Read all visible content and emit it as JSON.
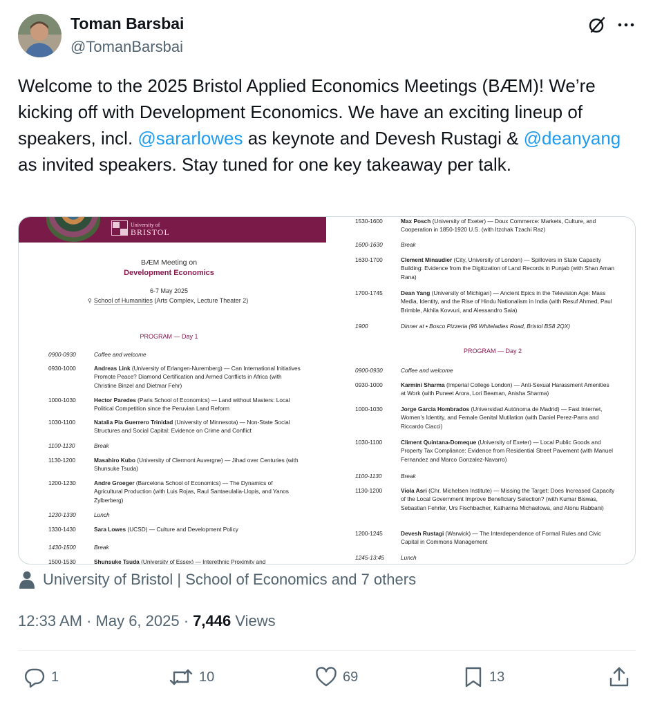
{
  "author": {
    "name": "Toman Barsbai",
    "handle": "@TomanBarsbai"
  },
  "icons": {
    "grok": "grok-icon",
    "more": "more-icon",
    "tagged": "person-icon",
    "reply": "reply-icon",
    "retweet": "retweet-icon",
    "like": "like-icon",
    "bookmark": "bookmark-icon",
    "share": "share-icon"
  },
  "tweet": {
    "text_part1": "Welcome to the 2025 Bristol Applied Economics Meetings (BÆM)! We’re kicking off with Development Economics. We have an exciting lineup of speakers, incl. ",
    "mention1": "@sararlowes",
    "text_part2": " as keynote and Devesh Rustagi & ",
    "mention2": "@deanyang",
    "text_part3": " as invited speakers. Stay tuned for one key takeaway per talk."
  },
  "media": {
    "logo_small": "University of",
    "logo_big": "BRISTOL",
    "meeting_title": "BÆM Meeting on",
    "meeting_subtitle": "Development Economics",
    "dates": "6-7 May 2025",
    "venue_name": "School of Humanities",
    "venue_detail": " (Arts Complex, Lecture Theater 2)",
    "day1_heading": "PROGRAM — Day 1",
    "day2_heading": "PROGRAM — Day 2",
    "day1": [
      {
        "time": "0900-0930",
        "speaker": "",
        "text": "Coffee and welcome",
        "brk": true
      },
      {
        "time": "0930-1000",
        "speaker": "Andreas Link",
        "text": " (University of Erlangen-Nuremberg) — Can International Initiatives Promote Peace? Diamond Certification and Armed Conflicts in Africa (with Christine Binzel and Dietmar Fehr)",
        "brk": false
      },
      {
        "time": "1000-1030",
        "speaker": "Hector Paredes",
        "text": " (Paris School of Economics) — Land without Masters: Local Political Competition since the Peruvian Land Reform",
        "brk": false
      },
      {
        "time": "1030-1100",
        "speaker": "Natalia Pia Guerrero Trinidad",
        "text": " (University of Minnesota) — Non-State Social Structures and Social Capital: Evidence on Crime and Conflict",
        "brk": false
      },
      {
        "time": "1100-1130",
        "speaker": "",
        "text": "Break",
        "brk": true
      },
      {
        "time": "1130-1200",
        "speaker": "Masahiro Kubo",
        "text": " (University of Clermont Auvergne) — Jihad over Centuries (with Shunsuke Tsuda)",
        "brk": false
      },
      {
        "time": "1200-1230",
        "speaker": "Andre Groeger",
        "text": " (Barcelona School of Economics) — The Dynamics of Agricultural Production (with Luis Rojas, Raul Santaeulalia-Llopis, and Yanos Zylberberg)",
        "brk": false
      },
      {
        "time": "1230-1330",
        "speaker": "",
        "text": "Lunch",
        "brk": true
      },
      {
        "time": "1330-1430",
        "speaker": "Sara Lowes",
        "text": " (UCSD) — Culture and Development Policy",
        "brk": false
      },
      {
        "time": "1430-1500",
        "speaker": "",
        "text": "Break",
        "brk": true
      },
      {
        "time": "1500-1530",
        "speaker": "Shunsuke Tsuda",
        "text": " (University of Essex) — Interethnic Proximity and",
        "brk": false
      }
    ],
    "day1_top": [
      {
        "time": "1530-1600",
        "speaker": "Max Posch",
        "text": " (University of Exeter) — Doux Commerce: Markets, Culture, and Cooperation in 1850-1920 U.S. (with Itzchak Tzachi Raz)",
        "brk": false
      },
      {
        "time": "1600-1630",
        "speaker": "",
        "text": "Break",
        "brk": true
      },
      {
        "time": "1630-1700",
        "speaker": "Clement Minaudier",
        "text": " (City, University of London) — Spillovers in State Capacity Building: Evidence from the Digitization of Land Records in Punjab (with Shan Aman Rana)",
        "brk": false
      },
      {
        "time": "1700-1745",
        "speaker": "Dean Yang",
        "text": " (University of Michigan) — Ancient Epics in the Television Age: Mass Media, Identity, and the Rise of Hindu Nationalism in India (with Resuf Ahmed, Paul Brimble, Akhila Kovvuri, and Alessandro Saia)",
        "brk": false
      },
      {
        "time": "1900",
        "speaker": "",
        "text": "Dinner at  • Bosco Pizzeria  (96 Whiteladies Road, Bristol BS8 2QX)",
        "brk": true
      }
    ],
    "day2": [
      {
        "time": "0900-0930",
        "speaker": "",
        "text": "Coffee and welcome",
        "brk": true
      },
      {
        "time": "0930-1000",
        "speaker": "Karmini Sharma",
        "text": " (Imperial College London) — Anti-Sexual Harassment Amenities at Work (with Puneet Arora, Lori Beaman, Anisha Sharma)",
        "brk": false
      },
      {
        "time": "1000-1030",
        "speaker": "Jorge Garcia Hombrados",
        "text": " (Universidad Autónoma de Madrid) — Fast Internet, Women’s Identity, and Female Genital Mutilation (with Daniel Perez-Parra  and Riccardo Ciacci)",
        "brk": false
      },
      {
        "time": "1030-1100",
        "speaker": "Climent Quintana-Domeque",
        "text": " (University of Exeter) — Local Public Goods and Property Tax Compliance: Evidence from Residential Street Pavement (with Manuel Fernandez and Marco Gonzalez-Navarro)",
        "brk": false
      },
      {
        "time": "1100-1130",
        "speaker": "",
        "text": "Break",
        "brk": true
      },
      {
        "time": "1130-1200",
        "speaker": "Viola Asri",
        "text": " (Chr. Michelsen Institute) — Missing the Target: Does Increased Capacity of the Local Government Improve Beneficiary Selection? (with Kumar Biswas, Sebastian Fehrler, Urs Fischbacher, Katharina Michaelowa, and Atonu Rabbani)",
        "brk": false
      },
      {
        "time": "1200-1245",
        "speaker": "Devesh Rustagi",
        "text": " (Warwick) — The Interdependence of Formal Rules and Civic Capital in Commons Management",
        "brk": false
      },
      {
        "time": "1245-13:45",
        "speaker": "",
        "text": "Lunch",
        "brk": true
      }
    ]
  },
  "tagged": {
    "text": "University of Bristol | School of Economics and 7 others"
  },
  "meta": {
    "time": "12:33 AM",
    "sep1": " · ",
    "date": "May 6, 2025",
    "sep2": " · ",
    "views_count": "7,446",
    "views_label": " Views"
  },
  "actions": {
    "replies": "1",
    "retweets": "10",
    "likes": "69",
    "bookmarks": "13"
  }
}
